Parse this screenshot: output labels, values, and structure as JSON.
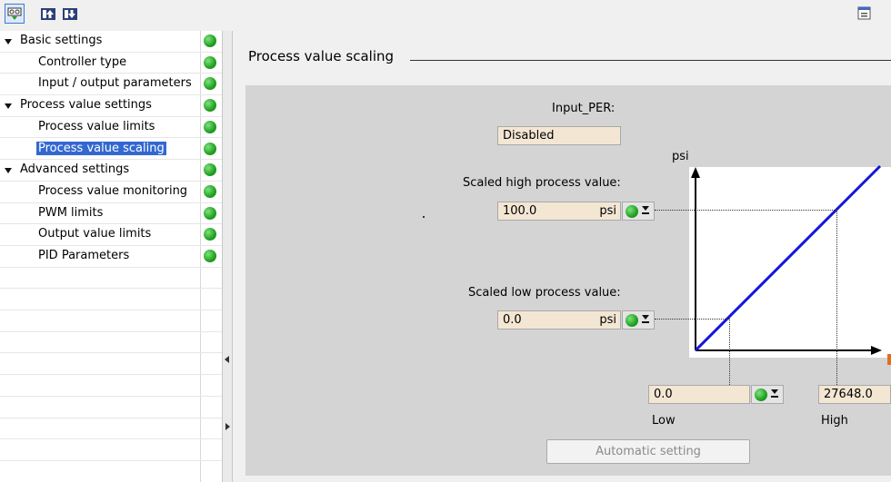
{
  "toolbar": {
    "buttons": [
      {
        "icon": "functional-view-icon",
        "active": true
      },
      {
        "icon": "upload-icon",
        "active": false
      },
      {
        "icon": "download-icon",
        "active": false
      }
    ],
    "right_icon": "pin-window-icon"
  },
  "tree": {
    "items": [
      {
        "label": "Basic settings",
        "level": 0,
        "expanded": true,
        "status": "ok"
      },
      {
        "label": "Controller type",
        "level": 1,
        "status": "ok"
      },
      {
        "label": "Input / output parameters",
        "level": 1,
        "status": "ok"
      },
      {
        "label": "Process value settings",
        "level": 0,
        "expanded": true,
        "status": "ok"
      },
      {
        "label": "Process value limits",
        "level": 1,
        "status": "ok"
      },
      {
        "label": "Process value scaling",
        "level": 1,
        "status": "ok",
        "selected": true
      },
      {
        "label": "Advanced settings",
        "level": 0,
        "expanded": true,
        "status": "ok"
      },
      {
        "label": "Process value monitoring",
        "level": 1,
        "status": "ok"
      },
      {
        "label": "PWM limits",
        "level": 1,
        "status": "ok"
      },
      {
        "label": "Output value limits",
        "level": 1,
        "status": "ok"
      },
      {
        "label": "PID Parameters",
        "level": 1,
        "status": "ok"
      }
    ]
  },
  "section": {
    "title": "Process value scaling"
  },
  "form": {
    "input_per_label": "Input_PER:",
    "input_per_value": "Disabled",
    "scaled_high_label": "Scaled high process value:",
    "scaled_high_value": "100.0",
    "scaled_high_unit": "psi",
    "scaled_low_label": "Scaled low process value:",
    "scaled_low_value": "0.0",
    "scaled_low_unit": "psi",
    "low_value": "0.0",
    "low_label": "Low",
    "high_value": "27648.0",
    "high_label": "High",
    "auto_button": "Automatic setting"
  },
  "chart": {
    "y_unit": "psi",
    "colors": {
      "line": "#1515d8",
      "status_ok": "#20a020"
    }
  }
}
